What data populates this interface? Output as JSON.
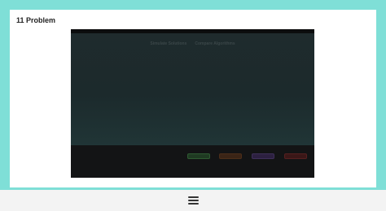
{
  "card": {
    "title": "11 Problem"
  },
  "player": {
    "tabs": [
      "Simulate Solutions",
      "Compare Algorithms"
    ],
    "controls": {
      "green_label": "",
      "orange_label": "",
      "purple_label": "",
      "red_label": ""
    }
  },
  "colors": {
    "background": "#7fdfd7",
    "card": "#ffffff",
    "player": "#151718",
    "bottom_bar": "#f3f3f3"
  },
  "icons": {
    "menu": "hamburger-icon"
  }
}
